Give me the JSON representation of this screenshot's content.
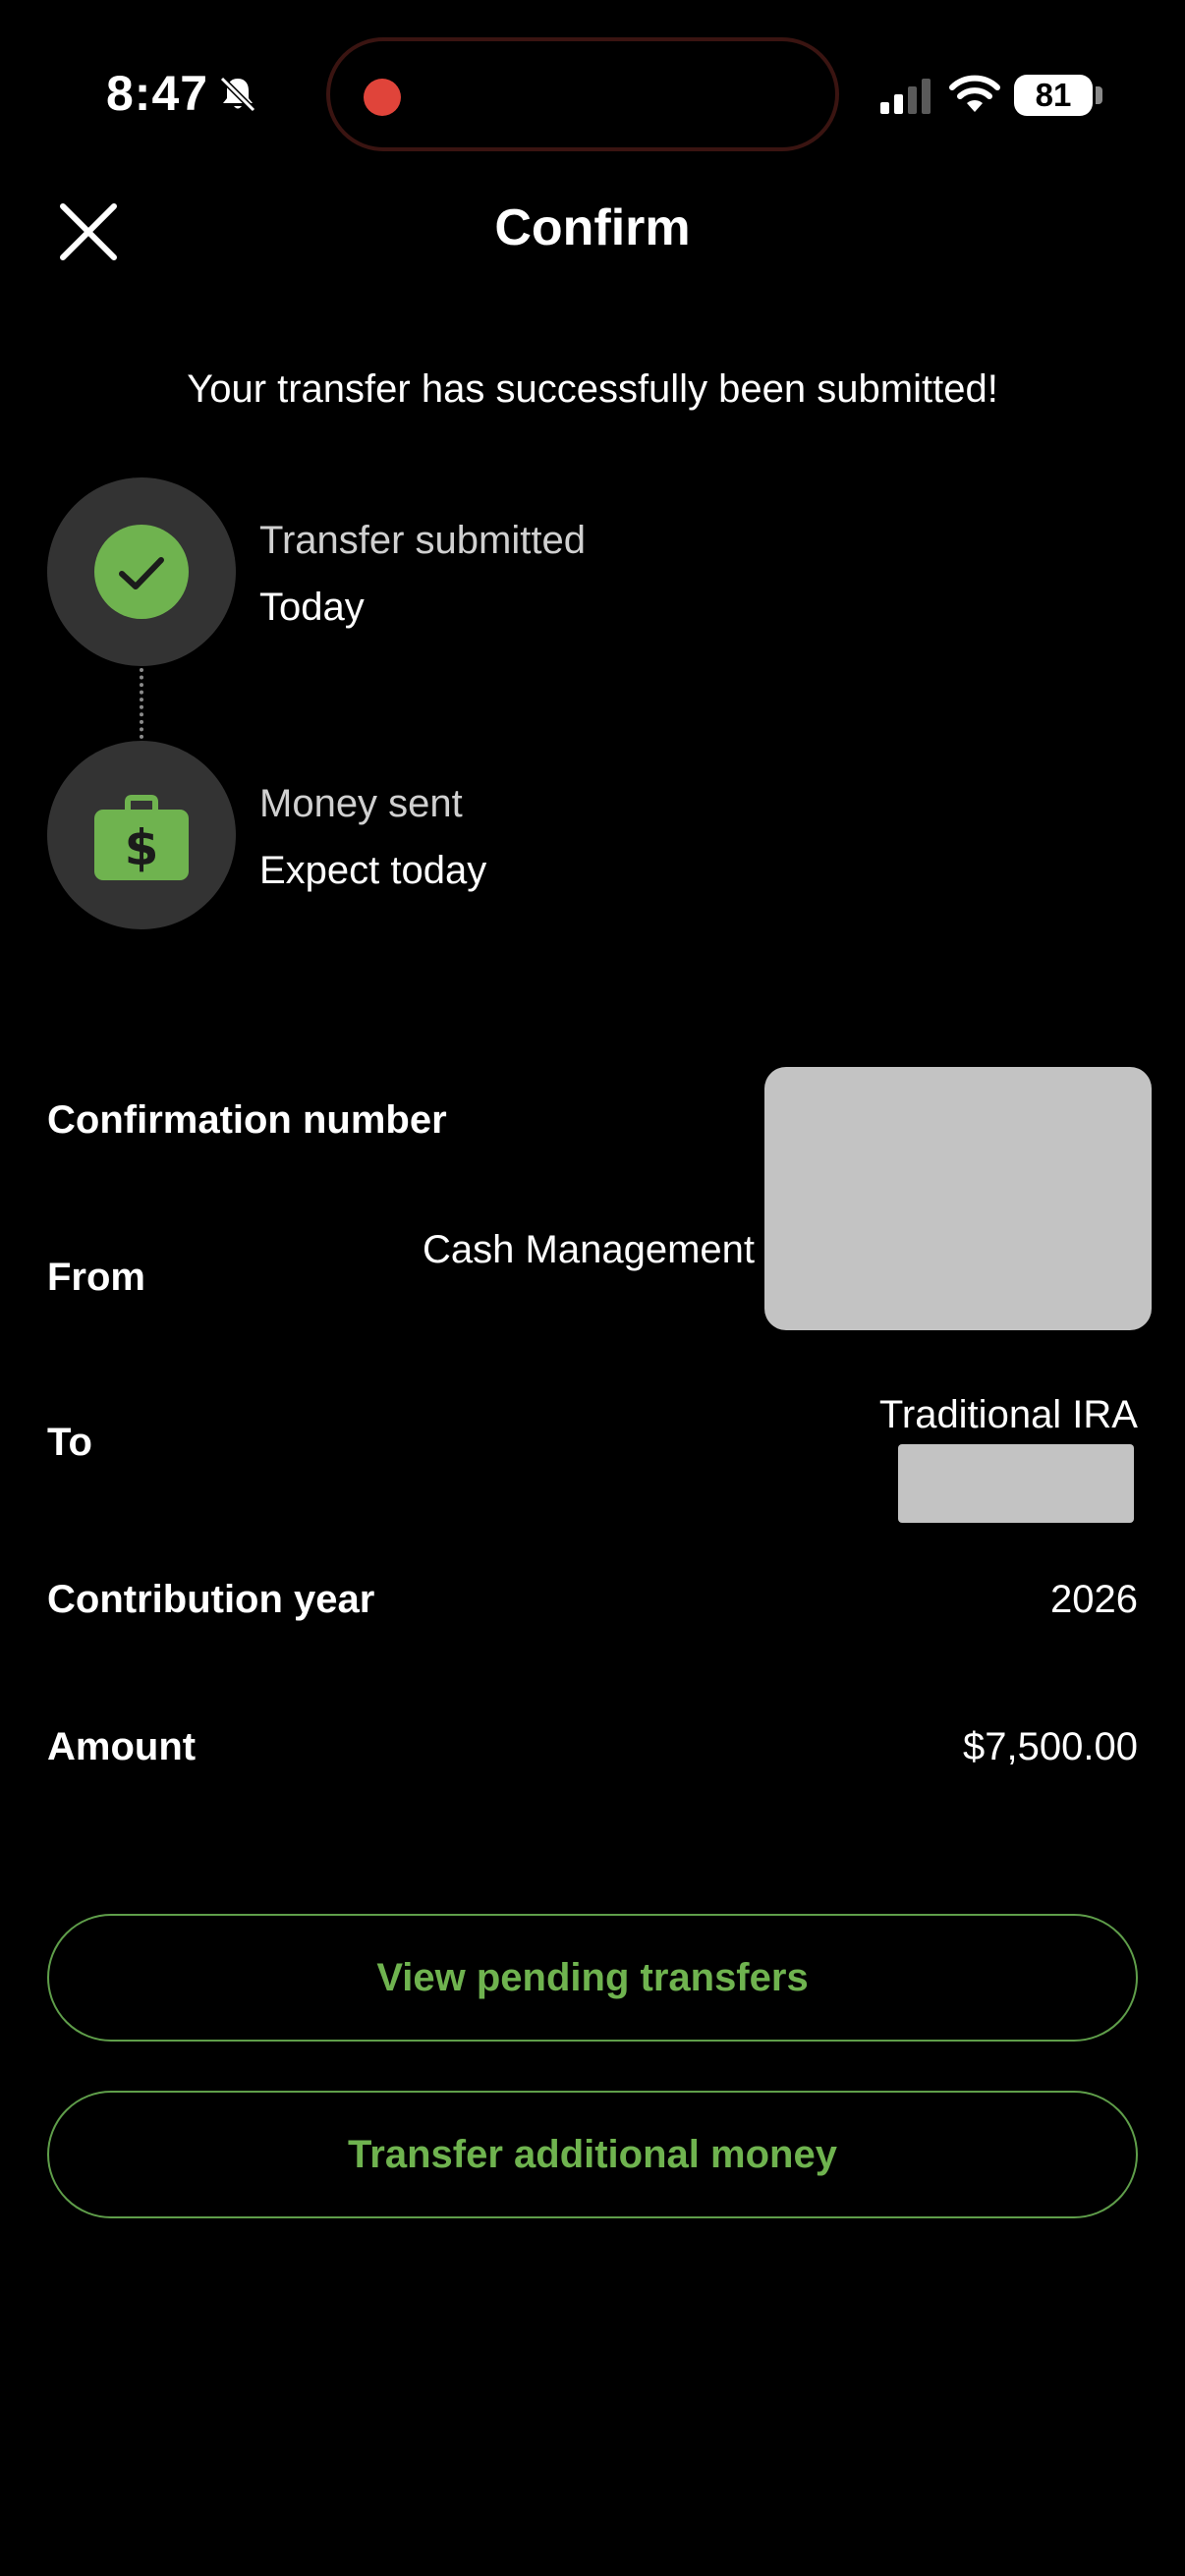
{
  "status_bar": {
    "time": "8:47",
    "battery": "81"
  },
  "header": {
    "title": "Confirm"
  },
  "message": "Your transfer has successfully been submitted!",
  "timeline": [
    {
      "label": "Transfer submitted",
      "sub": "Today"
    },
    {
      "label": "Money sent",
      "sub": "Expect today"
    }
  ],
  "details": {
    "confirmation_label": "Confirmation number",
    "from_label": "From",
    "from_value": "Cash Management",
    "to_label": "To",
    "to_value": "Traditional IRA",
    "year_label": "Contribution year",
    "year_value": "2026",
    "amount_label": "Amount",
    "amount_value": "$7,500.00"
  },
  "buttons": {
    "pending": "View pending transfers",
    "additional": "Transfer additional money"
  },
  "colors": {
    "accent_green": "#6fb34f",
    "background": "#000000",
    "recording_red": "#e0443a"
  },
  "icons": [
    "bell-slash-icon",
    "signal-icon",
    "wifi-icon",
    "close-icon",
    "checkmark-icon",
    "briefcase-dollar-icon"
  ]
}
